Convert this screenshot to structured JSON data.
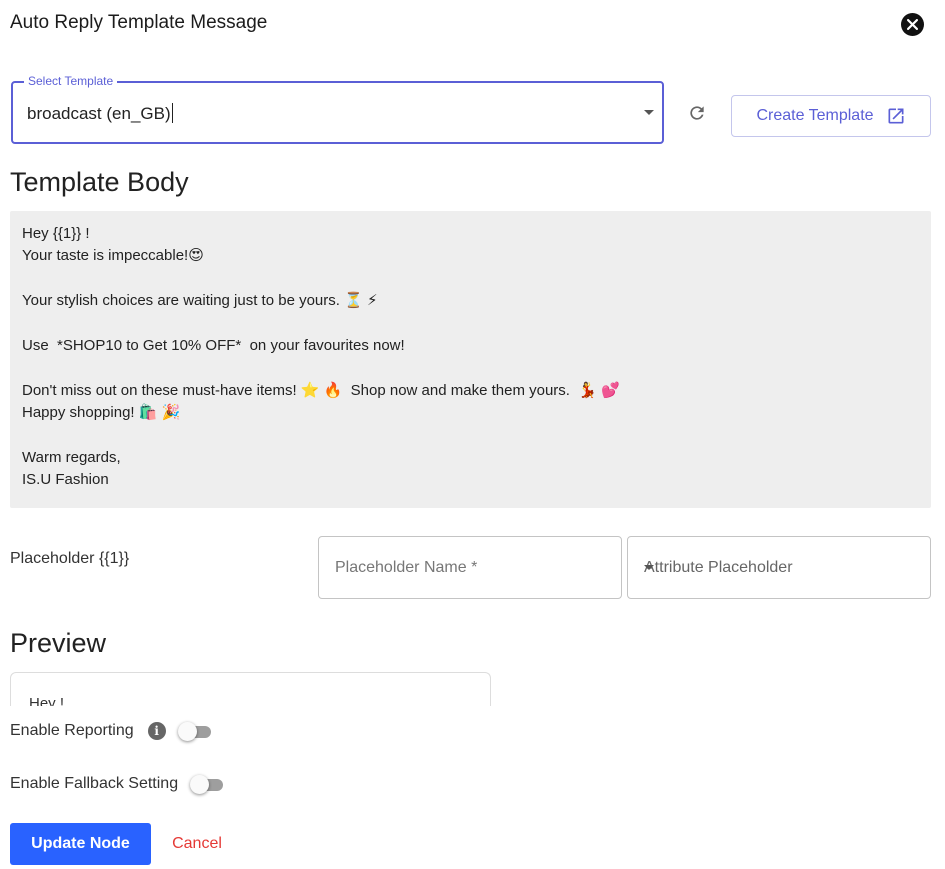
{
  "dialog": {
    "title": "Auto Reply Template Message"
  },
  "template_select": {
    "label": "Select Template",
    "value": "broadcast (en_GB)"
  },
  "create_template": {
    "label": "Create Template"
  },
  "template_body": {
    "heading": "Template Body",
    "lines": [
      "Hey {{1}} !",
      "Your taste is impeccable!😍",
      "",
      "Your stylish choices are waiting just to be yours. ⏳ ⚡",
      "",
      "Use  *SHOP10 to Get 10% OFF*  on your favourites now!",
      "",
      "Don't miss out on these must-have items! ⭐ 🔥  Shop now and make them yours.  💃 💕",
      "Happy shopping! 🛍️ 🎉",
      "",
      "Warm regards,",
      "IS.U Fashion"
    ]
  },
  "placeholder": {
    "label": "Placeholder {{1}}",
    "name_placeholder": "Placeholder Name *",
    "attribute_placeholder": "Attribute Placeholder"
  },
  "preview": {
    "heading": "Preview",
    "text": "Hey  !"
  },
  "settings": {
    "enable_reporting_label": "Enable Reporting",
    "enable_reporting": false,
    "enable_fallback_label": "Enable Fallback Setting",
    "enable_fallback": false
  },
  "actions": {
    "update_label": "Update Node",
    "cancel_label": "Cancel"
  },
  "colors": {
    "accent": "#5b5fd6",
    "primary_button": "#2962ff",
    "cancel": "#e53935"
  }
}
